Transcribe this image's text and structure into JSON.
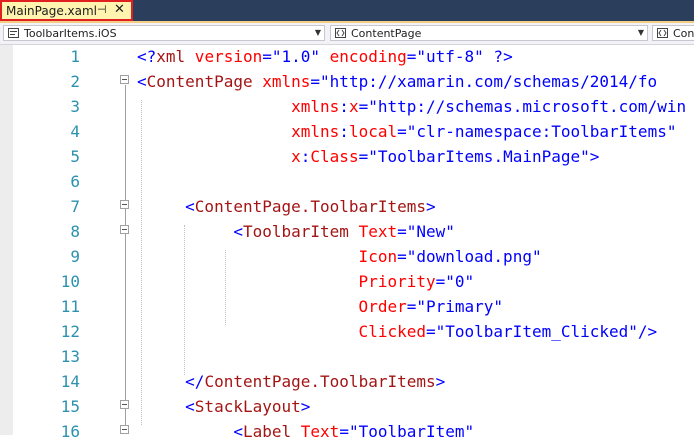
{
  "tab": {
    "title": "MainPage.xaml",
    "pin_icon": "pin-icon",
    "close_icon": "close-icon"
  },
  "navbar": {
    "project": "ToolbarItems.iOS",
    "type": "ContentPage",
    "member": "Conte"
  },
  "editor": {
    "lines": [
      {
        "n": "1",
        "parts": [
          [
            "blue",
            "<?"
          ],
          [
            "brown",
            "xml"
          ],
          [
            "red",
            " version"
          ],
          [
            "blue",
            "=\"1.0\""
          ],
          [
            "red",
            " encoding"
          ],
          [
            "blue",
            "=\"utf-8\""
          ],
          [
            "blue",
            " ?>"
          ]
        ]
      },
      {
        "n": "2",
        "parts": [
          [
            "blue",
            "<"
          ],
          [
            "brown",
            "ContentPage"
          ],
          [
            "red",
            " xmlns"
          ],
          [
            "blue",
            "=\"http://xamarin.com/schemas/2014/fo"
          ]
        ]
      },
      {
        "n": "3",
        "parts": [
          [
            "red",
            "                xmlns"
          ],
          [
            "blue",
            ":"
          ],
          [
            "red",
            "x"
          ],
          [
            "blue",
            "=\"http://schemas.microsoft.com/win"
          ]
        ]
      },
      {
        "n": "4",
        "parts": [
          [
            "red",
            "                xmlns"
          ],
          [
            "blue",
            ":"
          ],
          [
            "red",
            "local"
          ],
          [
            "blue",
            "=\"clr-namespace:ToolbarItems\""
          ]
        ]
      },
      {
        "n": "5",
        "parts": [
          [
            "red",
            "                x"
          ],
          [
            "blue",
            ":"
          ],
          [
            "red",
            "Class"
          ],
          [
            "blue",
            "=\"ToolbarItems.MainPage\">"
          ]
        ]
      },
      {
        "n": "6",
        "parts": []
      },
      {
        "n": "7",
        "parts": [
          [
            "blue",
            "     <"
          ],
          [
            "brown",
            "ContentPage.ToolbarItems"
          ],
          [
            "blue",
            ">"
          ]
        ]
      },
      {
        "n": "8",
        "parts": [
          [
            "blue",
            "          <"
          ],
          [
            "brown",
            "ToolbarItem"
          ],
          [
            "red",
            " Text"
          ],
          [
            "blue",
            "=\"New\""
          ]
        ]
      },
      {
        "n": "9",
        "parts": [
          [
            "red",
            "                       Icon"
          ],
          [
            "blue",
            "=\"download.png\""
          ]
        ]
      },
      {
        "n": "10",
        "parts": [
          [
            "red",
            "                       Priority"
          ],
          [
            "blue",
            "=\"0\""
          ]
        ]
      },
      {
        "n": "11",
        "parts": [
          [
            "red",
            "                       Order"
          ],
          [
            "blue",
            "=\"Primary\""
          ]
        ]
      },
      {
        "n": "12",
        "parts": [
          [
            "red",
            "                       Clicked"
          ],
          [
            "blue",
            "=\"ToolbarItem_Clicked\"/>"
          ]
        ]
      },
      {
        "n": "13",
        "parts": []
      },
      {
        "n": "14",
        "parts": [
          [
            "blue",
            "     </"
          ],
          [
            "brown",
            "ContentPage.ToolbarItems"
          ],
          [
            "blue",
            ">"
          ]
        ]
      },
      {
        "n": "15",
        "parts": [
          [
            "blue",
            "     <"
          ],
          [
            "brown",
            "StackLayout"
          ],
          [
            "blue",
            ">"
          ]
        ]
      },
      {
        "n": "16",
        "parts": [
          [
            "blue",
            "          <"
          ],
          [
            "brown",
            "Label"
          ],
          [
            "red",
            " Text"
          ],
          [
            "blue",
            "=\"ToolbarItem\""
          ]
        ]
      }
    ]
  },
  "colors": {
    "tab_active_bg": "#fff3b0",
    "tab_strip": "#2b3e5c",
    "highlight_border": "#e02020",
    "line_number": "#2b91af"
  }
}
